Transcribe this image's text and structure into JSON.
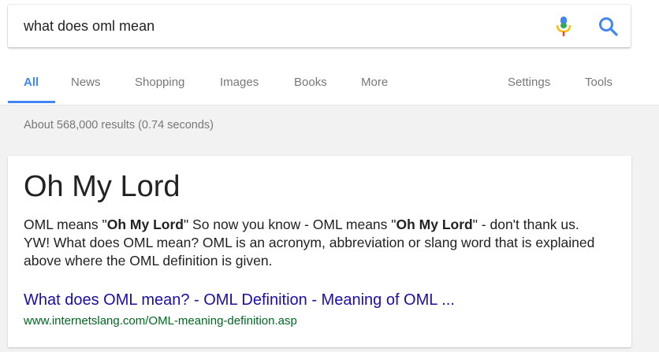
{
  "search": {
    "query": "what does oml mean",
    "mic_icon": "microphone-icon",
    "search_icon": "magnifier-icon"
  },
  "tabs": [
    {
      "label": "All",
      "active": true
    },
    {
      "label": "News"
    },
    {
      "label": "Shopping"
    },
    {
      "label": "Images"
    },
    {
      "label": "Books"
    },
    {
      "label": "More"
    },
    {
      "label": "Settings"
    },
    {
      "label": "Tools"
    }
  ],
  "result_stats": "About 568,000 results (0.74 seconds)",
  "featured": {
    "title": "Oh My Lord",
    "snippet": [
      {
        "text": "OML means \""
      },
      {
        "text": "Oh My Lord",
        "bold": true
      },
      {
        "text": "\" So now you know - OML means \""
      },
      {
        "text": "Oh My Lord",
        "bold": true
      },
      {
        "text": "\" - don't thank us. YW! What does OML mean? OML is an acronym, abbreviation or slang word that is explained above where the OML definition is given."
      }
    ],
    "link_text": "What does OML mean? - OML Definition - Meaning of OML ...",
    "url": "www.internetslang.com/OML-meaning-definition.asp"
  },
  "colors": {
    "accent": "#4285f4",
    "link": "#1a0dab",
    "url": "#006621",
    "mic_top": "#4285f4",
    "mic_mid": "#34a853",
    "mic_low": "#fbbc05",
    "mic_stand": "#ea4335"
  }
}
